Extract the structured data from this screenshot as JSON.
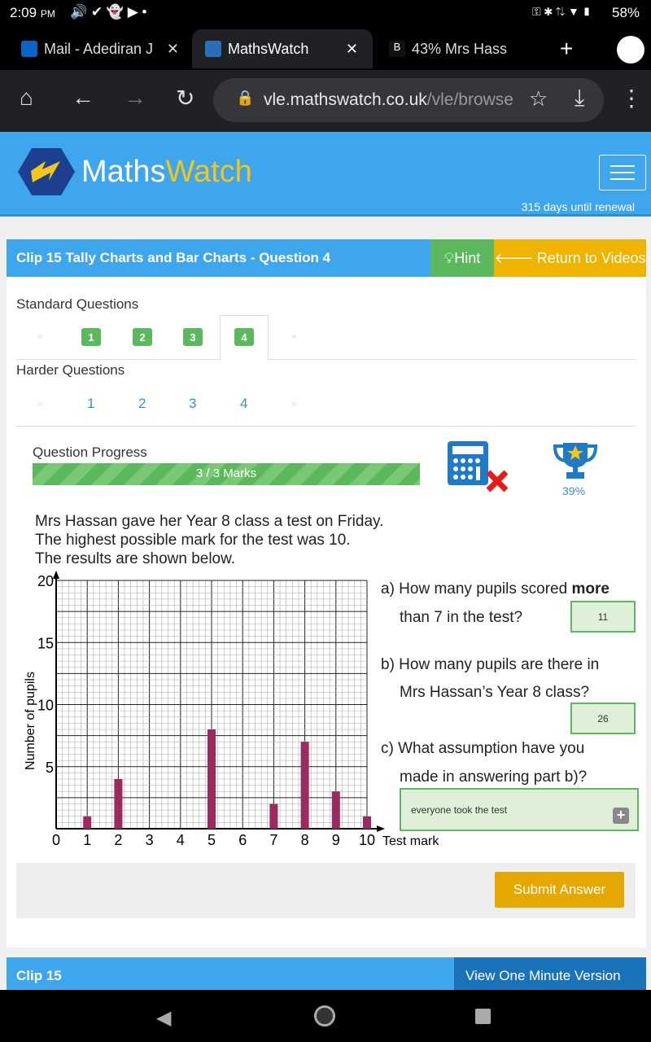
{
  "status_bar": {
    "time": "2:09",
    "ampm": "PM",
    "battery": "58%"
  },
  "browser": {
    "tabs": [
      {
        "label": "Mail - Adediran J",
        "favicon": "outlook-icon"
      },
      {
        "label": "MathsWatch",
        "favicon": "mathswatch-icon",
        "active": true
      },
      {
        "label": "43% Mrs Hass",
        "favicon": "brainly-icon"
      }
    ],
    "url_host": "vle.mathswatch.co.uk",
    "url_path": "/vle/browse"
  },
  "site": {
    "logo_a": "Maths",
    "logo_b": "Watch",
    "renewal": "315 days until renewal",
    "brand_color": "#3ea6ec"
  },
  "question": {
    "title": "Clip 15 Tally Charts and Bar Charts - Question 4",
    "hint": "Hint",
    "return": "Return to Videos",
    "standard_label": "Standard Questions",
    "standard_pages": [
      "1",
      "2",
      "3",
      "4"
    ],
    "active_page": "4",
    "harder_label": "Harder Questions",
    "harder_pages": [
      "1",
      "2",
      "3",
      "4"
    ],
    "progress_label": "Question Progress",
    "progress_text": "3 / 3 Marks",
    "progress_fraction": 1.0,
    "trophy_percent": "39%",
    "intro": [
      "Mrs Hassan gave her Year 8 class a test on Friday.",
      "The highest possible mark for the test was 10.",
      "The results are shown below."
    ],
    "part_a": {
      "pre": "a) How many pupils scored ",
      "bold": "more",
      "line2": "than 7 in the test?",
      "answer": "11"
    },
    "part_b": {
      "line1": "b) How many pupils are there in",
      "line2": "Mrs Hassan’s Year 8 class?",
      "answer": "26"
    },
    "part_c": {
      "line1": "c) What assumption have you",
      "line2": "made in answering part b)?",
      "answer": "everyone took the test"
    },
    "submit": "Submit Answer"
  },
  "footer": {
    "clip": "Clip 15",
    "one_minute": "View One Minute Version"
  },
  "chart_data": {
    "type": "bar",
    "xlabel": "Test mark",
    "ylabel": "Number of pupils",
    "x": [
      0,
      1,
      2,
      3,
      4,
      5,
      6,
      7,
      8,
      9,
      10
    ],
    "values": [
      0,
      1,
      4,
      0,
      0,
      8,
      0,
      2,
      7,
      3,
      1
    ],
    "xlim": [
      0,
      10
    ],
    "ylim": [
      0,
      20
    ],
    "yticks": [
      "5",
      "10",
      "15",
      "20"
    ],
    "xticks": [
      "0",
      "1",
      "2",
      "3",
      "4",
      "5",
      "6",
      "7",
      "8",
      "9",
      "10"
    ],
    "grid": true,
    "bar_color": "#9b2b5f"
  }
}
